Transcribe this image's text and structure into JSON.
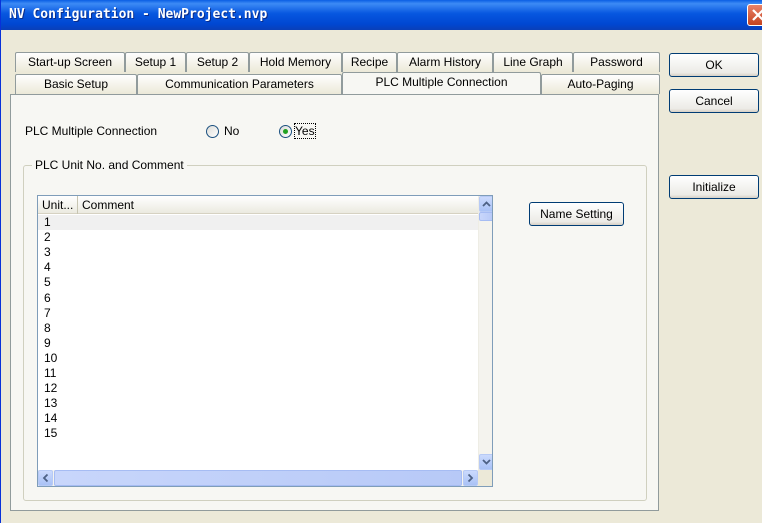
{
  "window": {
    "title": "NV Configuration - NewProject.nvp"
  },
  "tabs_row1": [
    "Start-up Screen",
    "Setup 1",
    "Setup 2",
    "Hold Memory",
    "Recipe",
    "Alarm History",
    "Line Graph",
    "Password"
  ],
  "tabs_row2": [
    "Basic Setup",
    "Communication Parameters",
    "PLC Multiple Connection",
    "Auto-Paging"
  ],
  "active_tab": "PLC Multiple Connection",
  "plc_multiple_connection": {
    "label": "PLC Multiple Connection",
    "option_no": "No",
    "option_yes": "Yes",
    "selected": "Yes"
  },
  "group": {
    "title": "PLC Unit No. and Comment",
    "columns": [
      "Unit...",
      "Comment"
    ],
    "rows": [
      {
        "unit": "1",
        "comment": ""
      },
      {
        "unit": "2",
        "comment": ""
      },
      {
        "unit": "3",
        "comment": ""
      },
      {
        "unit": "4",
        "comment": ""
      },
      {
        "unit": "5",
        "comment": ""
      },
      {
        "unit": "6",
        "comment": ""
      },
      {
        "unit": "7",
        "comment": ""
      },
      {
        "unit": "8",
        "comment": ""
      },
      {
        "unit": "9",
        "comment": ""
      },
      {
        "unit": "10",
        "comment": ""
      },
      {
        "unit": "11",
        "comment": ""
      },
      {
        "unit": "12",
        "comment": ""
      },
      {
        "unit": "13",
        "comment": ""
      },
      {
        "unit": "14",
        "comment": ""
      },
      {
        "unit": "15",
        "comment": ""
      }
    ],
    "name_setting_button": "Name Setting"
  },
  "buttons": {
    "ok": "OK",
    "cancel": "Cancel",
    "initialize": "Initialize"
  },
  "colors": {
    "title_bar": "#0058e6",
    "selection_radio": "#21a121"
  }
}
